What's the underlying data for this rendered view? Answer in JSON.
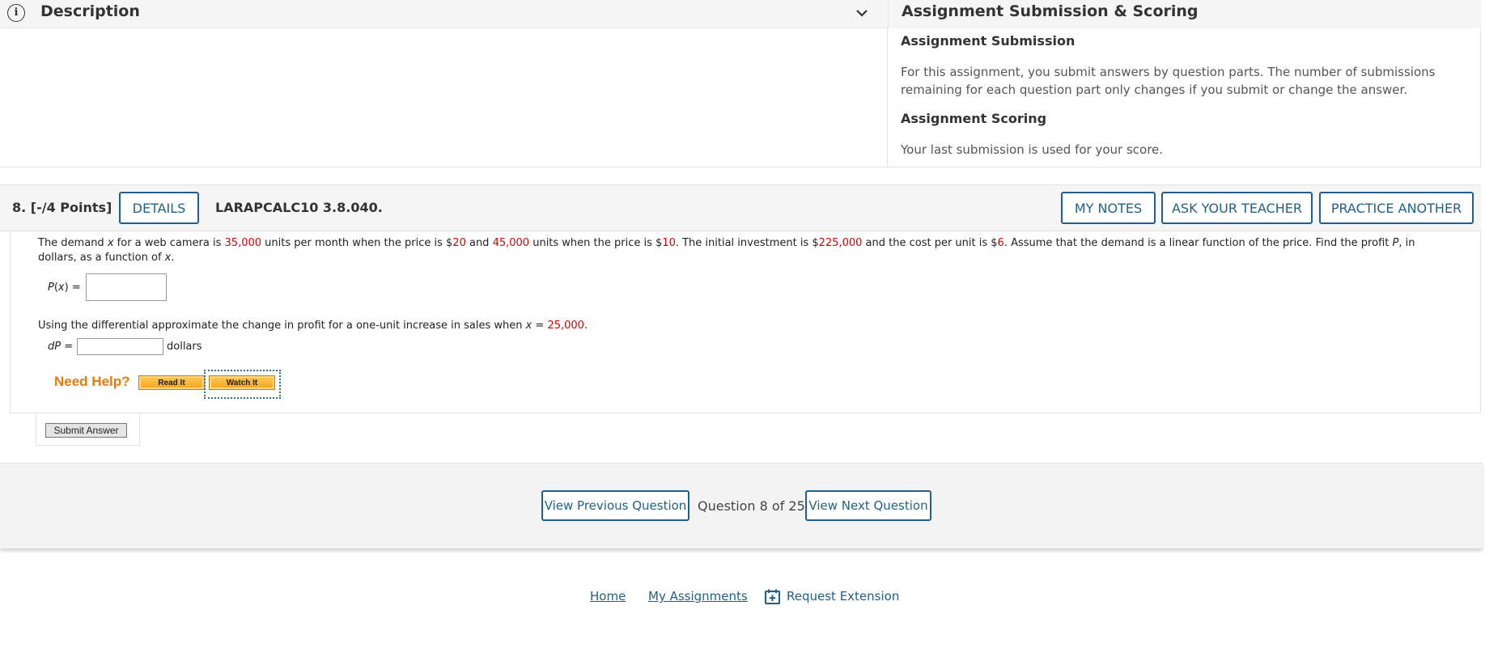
{
  "description": {
    "title": "Description",
    "info_icon": "i"
  },
  "scoring": {
    "title": "Assignment Submission & Scoring",
    "submission_heading": "Assignment Submission",
    "submission_text": "For this assignment, you submit answers by question parts. The number of submissions remaining for each question part only changes if you submit or change the answer.",
    "scoring_heading": "Assignment Scoring",
    "scoring_text": "Your last submission is used for your score."
  },
  "question": {
    "points": "8. [-/4 Points]",
    "details_label": "DETAILS",
    "code": "LARAPCALC10 3.8.040.",
    "my_notes_label": "MY NOTES",
    "ask_teacher_label": "ASK YOUR TEACHER",
    "practice_label": "PRACTICE ANOTHER",
    "text": {
      "t1": "The demand ",
      "var_x": "x",
      "t2": " for a web camera is ",
      "v1": "35,000",
      "t3": " units per month when the price is $",
      "v2": "20",
      "t4": " and ",
      "v3": "45,000",
      "t5": " units when the price is $",
      "v4": "10",
      "t6": ". The initial investment is $",
      "v5": "225,000",
      "t7": " and the cost per unit is $",
      "v6": "6",
      "t8": ". Assume that the demand is a linear function of the price. Find the profit ",
      "var_p": "P",
      "t9": ", in dollars, as a function of ",
      "var_x2": "x",
      "t10": "."
    },
    "px_label_a": "P",
    "px_label_b": "(",
    "px_label_x": "x",
    "px_label_c": ") =",
    "part2": {
      "t1": "Using the differential approximate the change in profit for a one-unit increase in sales when ",
      "var_x": "x",
      "t2": " = ",
      "value": "25,000",
      "t3": "."
    },
    "dp_label_a": "dP",
    "dp_label_b": " =",
    "dp_unit": "dollars",
    "need_help": "Need Help?",
    "read_it": "Read It",
    "watch_it": "Watch It",
    "submit_label": "Submit Answer"
  },
  "nav": {
    "prev_label": "View Previous Question",
    "position": "Question 8 of 25",
    "next_label": "View Next Question"
  },
  "footer": {
    "home": "Home",
    "my_assignments": "My Assignments",
    "request_extension": "Request Extension",
    "extension_icon": "calendar-plus-icon"
  },
  "colors": {
    "accent": "#1f5f92",
    "value_red": "#e10000",
    "help_orange": "#e87b0c"
  }
}
